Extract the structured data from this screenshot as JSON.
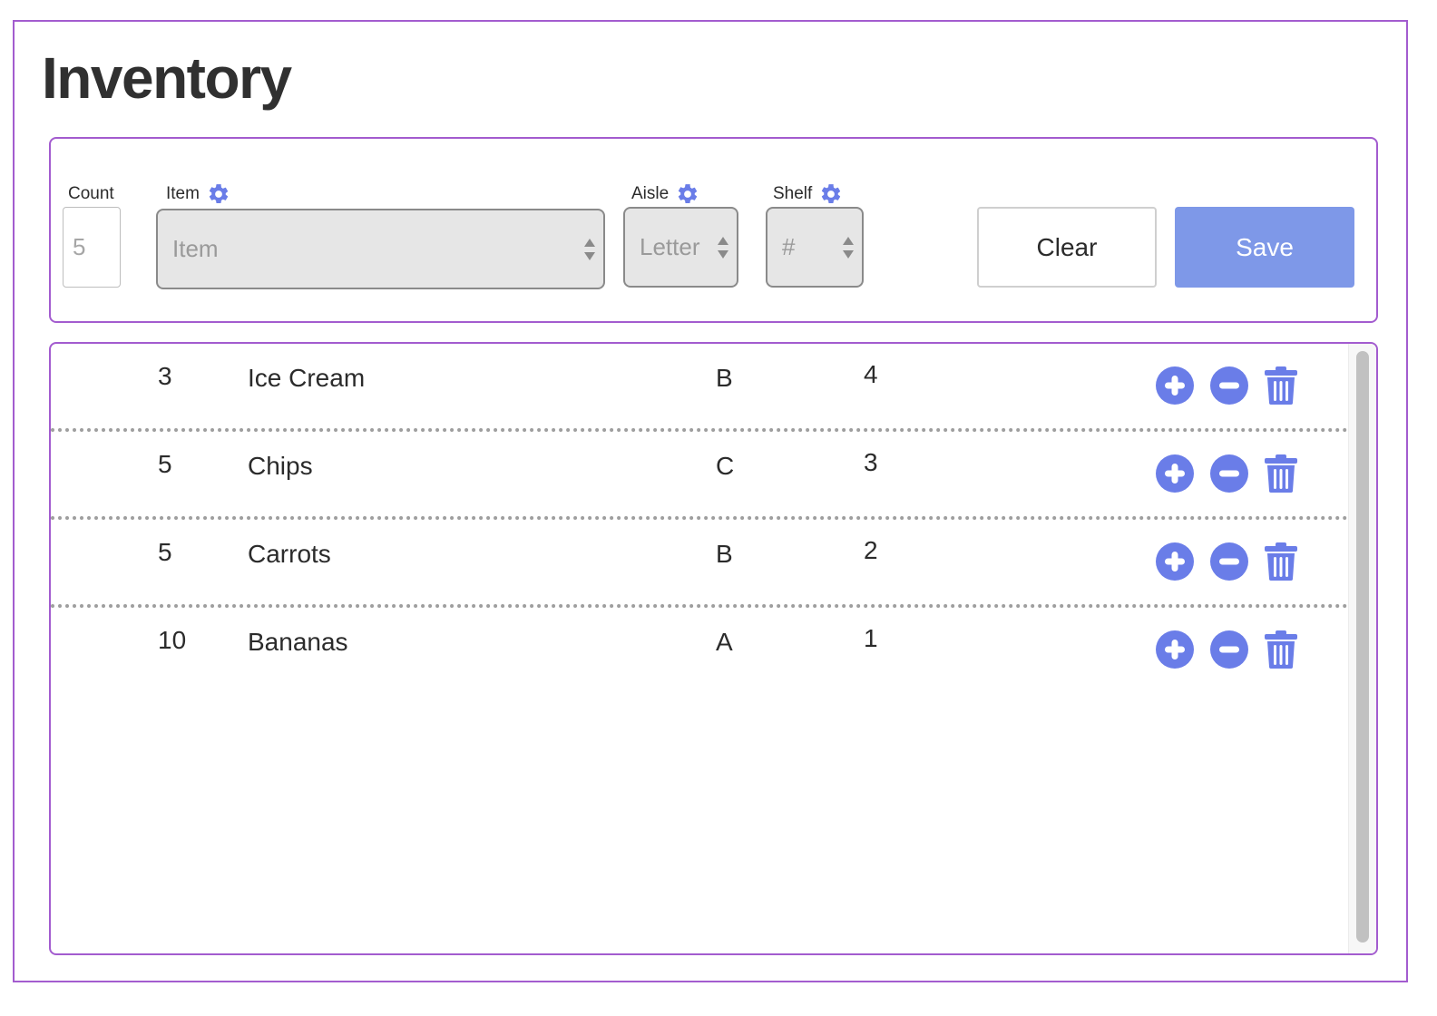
{
  "page": {
    "title": "Inventory"
  },
  "form": {
    "count_label": "Count",
    "count_placeholder": "5",
    "item_label": "Item",
    "item_placeholder": "Item",
    "aisle_label": "Aisle",
    "aisle_placeholder": "Letter",
    "shelf_label": "Shelf",
    "shelf_placeholder": "#",
    "clear_label": "Clear",
    "save_label": "Save",
    "settings_icon": "gear-icon"
  },
  "inventory": {
    "rows": [
      {
        "count": "3",
        "item": "Ice Cream",
        "aisle": "B",
        "shelf": "4"
      },
      {
        "count": "5",
        "item": "Chips",
        "aisle": "C",
        "shelf": "3"
      },
      {
        "count": "5",
        "item": "Carrots",
        "aisle": "B",
        "shelf": "2"
      },
      {
        "count": "10",
        "item": "Bananas",
        "aisle": "A",
        "shelf": "1"
      }
    ],
    "row_actions": [
      "plus-circle-icon",
      "minus-circle-icon",
      "trash-icon"
    ]
  },
  "colors": {
    "accent": "#6a7de8",
    "save_button": "#7e98e8",
    "frame_border": "#a35ccf",
    "select_background": "#e6e6e6"
  }
}
